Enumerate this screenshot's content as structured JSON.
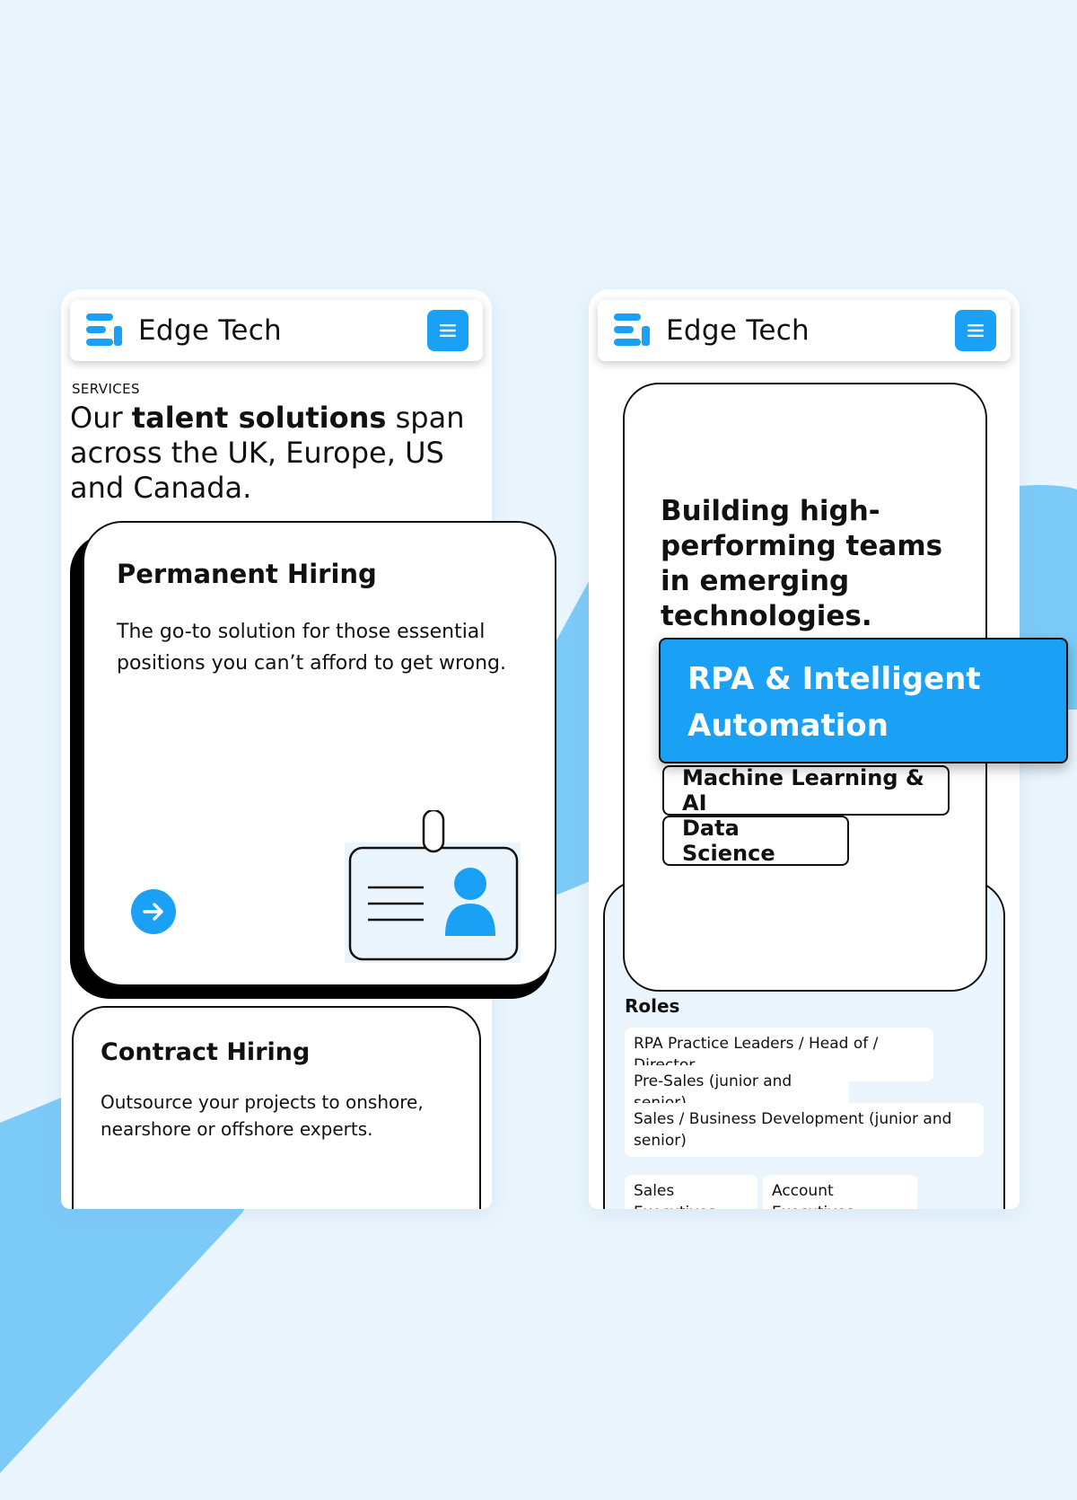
{
  "brand": {
    "name": "Edge Tech",
    "accent_color": "#1aa0f5",
    "logo_icon": "edge-tech-logo-icon",
    "menu_icon": "hamburger-menu-icon"
  },
  "left_screen": {
    "eyebrow": "SERVICES",
    "headline": {
      "pre": "Our ",
      "bold": "talent solutions",
      "post": " span across the UK, Europe, US and Canada."
    },
    "cards": [
      {
        "title": "Permanent Hiring",
        "description": "The go-to solution for those essential positions you can’t afford to get wrong.",
        "action_icon": "arrow-right-icon",
        "illustration": "id-badge-icon"
      },
      {
        "title": "Contract Hiring",
        "description": "Outsource your projects to onshore, nearshore or offshore experts."
      }
    ]
  },
  "right_screen": {
    "headline": "Building high-performing teams in emerging technologies.",
    "active_pill": "RPA & Intelligent Automation",
    "pills": [
      "Machine Learning & AI",
      "Data Science"
    ],
    "roles_title": "Roles",
    "roles": [
      "RPA Practice Leaders / Head of / Director",
      "Pre-Sales (junior and senior)",
      "Sales / Business Development (junior and senior)",
      "Sales Executives",
      "Account Executives"
    ]
  }
}
